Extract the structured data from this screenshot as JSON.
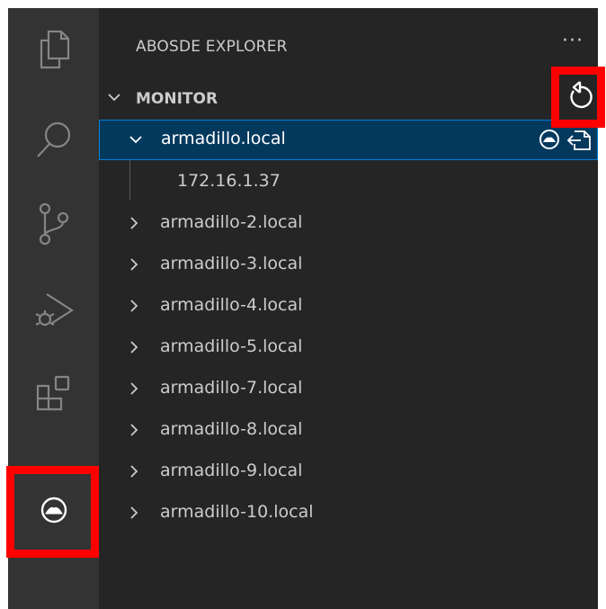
{
  "sidebar": {
    "title": "ABOSDE EXPLORER",
    "more_label": "···",
    "section_label": "MONITOR"
  },
  "activity_bar": {
    "items": [
      "explorer-icon",
      "search-icon",
      "source-control-icon",
      "run-debug-icon",
      "extensions-icon",
      "abosde-icon"
    ],
    "active": "abosde-icon"
  },
  "tree": {
    "expanded": {
      "label": "armadillo.local",
      "child": "172.16.1.37"
    },
    "items": [
      {
        "label": "armadillo-2.local"
      },
      {
        "label": "armadillo-3.local"
      },
      {
        "label": "armadillo-4.local"
      },
      {
        "label": "armadillo-5.local"
      },
      {
        "label": "armadillo-7.local"
      },
      {
        "label": "armadillo-8.local"
      },
      {
        "label": "armadillo-9.local"
      },
      {
        "label": "armadillo-10.local"
      }
    ]
  },
  "colors": {
    "activity_bg": "#333333",
    "sidebar_bg": "#252526",
    "selection_bg": "#04395e",
    "selection_border": "#007fd4",
    "highlight": "#ff0000"
  }
}
